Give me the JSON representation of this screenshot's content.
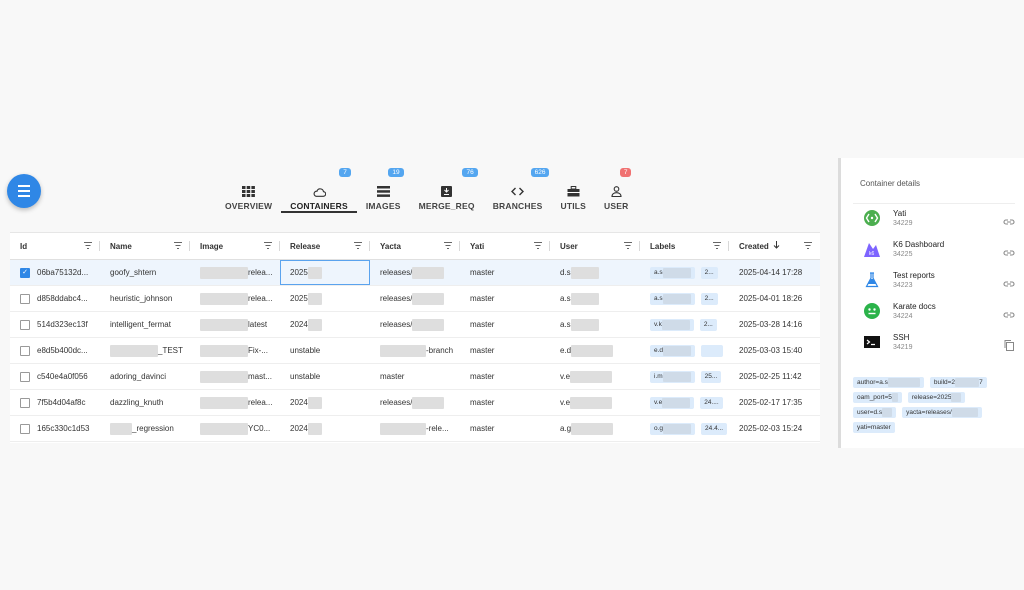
{
  "tabs": [
    {
      "label": "OVERVIEW",
      "badge": "",
      "icon": "grid-icon",
      "active": false
    },
    {
      "label": "CONTAINERS",
      "badge": "7",
      "icon": "cloud-icon",
      "active": true
    },
    {
      "label": "IMAGES",
      "badge": "19",
      "icon": "layers-icon",
      "active": false
    },
    {
      "label": "MERGE_REQ",
      "badge": "76",
      "icon": "merge-icon",
      "active": false
    },
    {
      "label": "BRANCHES",
      "badge": "626",
      "icon": "code-icon",
      "active": false
    },
    {
      "label": "UTILS",
      "badge": "",
      "icon": "toolbox-icon",
      "active": false
    },
    {
      "label": "USER",
      "badge": "7",
      "icon": "person-icon",
      "active": false,
      "badge_color": "#f07171"
    }
  ],
  "table": {
    "columns": [
      {
        "label": "Id",
        "width": 90
      },
      {
        "label": "Name",
        "width": 90
      },
      {
        "label": "Image",
        "width": 90
      },
      {
        "label": "Release",
        "width": 90
      },
      {
        "label": "Yacta",
        "width": 90
      },
      {
        "label": "Yati",
        "width": 90
      },
      {
        "label": "User",
        "width": 90
      },
      {
        "label": "Labels",
        "width": 89
      },
      {
        "label": "Created",
        "width": 91,
        "sort": "desc"
      }
    ],
    "rows": [
      {
        "id": "06ba75132d...",
        "name": "goofy_shtern",
        "image": "relea...",
        "release": "2025",
        "yacta": "releases/",
        "yati": "master",
        "user": "d.s",
        "labels": [
          "a.s",
          "2..."
        ],
        "created": "2025-04-14 17:28",
        "selected": true
      },
      {
        "id": "d858ddabc4...",
        "name": "heuristic_johnson",
        "image": "relea...",
        "release": "2025",
        "yacta": "releases/",
        "yati": "master",
        "user": "a.s",
        "labels": [
          "a.s",
          "2..."
        ],
        "created": "2025-04-01 18:26",
        "selected": false
      },
      {
        "id": "514d323ec13f",
        "name": "intelligent_fermat",
        "image": "latest",
        "release": "2024",
        "yacta": "releases/",
        "yati": "master",
        "user": "a.s",
        "labels": [
          "v.k",
          "2..."
        ],
        "created": "2025-03-28 14:16",
        "selected": false
      },
      {
        "id": "e8d5b400dc...",
        "name": "_TEST",
        "image": "Fix-...",
        "release": "unstable",
        "yacta": "-branch",
        "yati": "master",
        "user": "e.d",
        "labels": [
          "e.d",
          ""
        ],
        "created": "2025-03-03 15:40",
        "selected": false
      },
      {
        "id": "c540e4a0f056",
        "name": "adoring_davinci",
        "image": "mast...",
        "release": "unstable",
        "yacta": "master",
        "yati": "master",
        "user": "v.e",
        "labels": [
          "i.m",
          "25..."
        ],
        "created": "2025-02-25 11:42",
        "selected": false
      },
      {
        "id": "7f5b4d04af8c",
        "name": "dazzling_knuth",
        "image": "relea...",
        "release": "2024",
        "yacta": "releases/",
        "yati": "master",
        "user": "v.e",
        "labels": [
          "v.e",
          "24...."
        ],
        "created": "2025-02-17 17:35",
        "selected": false
      },
      {
        "id": "165c330c1d53",
        "name": "_regression",
        "image": "YC0...",
        "release": "2024",
        "yacta": "-rele...",
        "yati": "master",
        "user": "a.g",
        "labels": [
          "o.g",
          "24.4..."
        ],
        "created": "2025-02-03 15:24",
        "selected": false
      }
    ]
  },
  "details": {
    "title": "Container details",
    "services": [
      {
        "name": "Yati",
        "port": "34229",
        "icon": "yati-icon",
        "action": "link-icon"
      },
      {
        "name": "K6 Dashboard",
        "port": "34225",
        "icon": "k6-icon",
        "action": "link-icon"
      },
      {
        "name": "Test reports",
        "port": "34223",
        "icon": "flask-icon",
        "action": "link-icon"
      },
      {
        "name": "Karate docs",
        "port": "34224",
        "icon": "karate-icon",
        "action": "link-icon"
      },
      {
        "name": "SSH",
        "port": "34219",
        "icon": "terminal-icon",
        "action": "copy-icon"
      }
    ],
    "tags": [
      {
        "text": "author=a.s",
        "blur": 32
      },
      {
        "text": "build=2",
        "tail": "7",
        "blur": 24
      },
      {
        "text": "oam_port=5",
        "blur": 6
      },
      {
        "text": "release=2025",
        "blur": 10
      },
      {
        "text": "user=d.s",
        "blur": 10
      },
      {
        "text": "yacta=releases/",
        "blur": 26
      },
      {
        "text": "yati=master",
        "blur": 0
      }
    ]
  },
  "colors": {
    "accent": "#2f87e6",
    "badge": "#54a6f0",
    "badge_red": "#f07171",
    "chip": "#dcebfb",
    "selected_row": "#eef5fd"
  }
}
